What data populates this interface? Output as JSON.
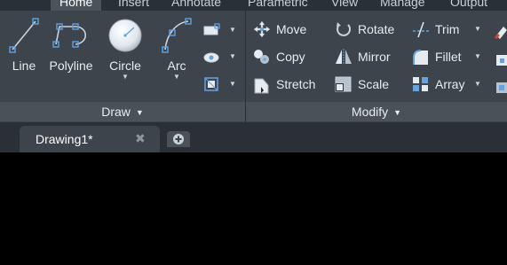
{
  "ribbon_tabs": [
    {
      "label": "Home",
      "active": true
    },
    {
      "label": "Insert",
      "active": false
    },
    {
      "label": "Annotate",
      "active": false
    },
    {
      "label": "Parametric",
      "active": false
    },
    {
      "label": "View",
      "active": false
    },
    {
      "label": "Manage",
      "active": false
    },
    {
      "label": "Output",
      "active": false
    }
  ],
  "draw_panel": {
    "title": "Draw",
    "tools": [
      {
        "label": "Line"
      },
      {
        "label": "Polyline"
      },
      {
        "label": "Circle"
      },
      {
        "label": "Arc"
      }
    ]
  },
  "modify_panel": {
    "title": "Modify",
    "tools": [
      {
        "label": "Move"
      },
      {
        "label": "Rotate"
      },
      {
        "label": "Trim"
      },
      {
        "label": "Copy"
      },
      {
        "label": "Mirror"
      },
      {
        "label": "Fillet"
      },
      {
        "label": "Stretch"
      },
      {
        "label": "Scale"
      },
      {
        "label": "Array"
      }
    ]
  },
  "document_tabs": [
    {
      "label": "Drawing1*"
    }
  ],
  "colors": {
    "ribbon_bg": "#3d444b",
    "panel_title_bg": "#4a5159",
    "tab_strip_bg": "#2a3038",
    "canvas_bg": "#000000",
    "icon_blue": "#5ea4e6"
  }
}
